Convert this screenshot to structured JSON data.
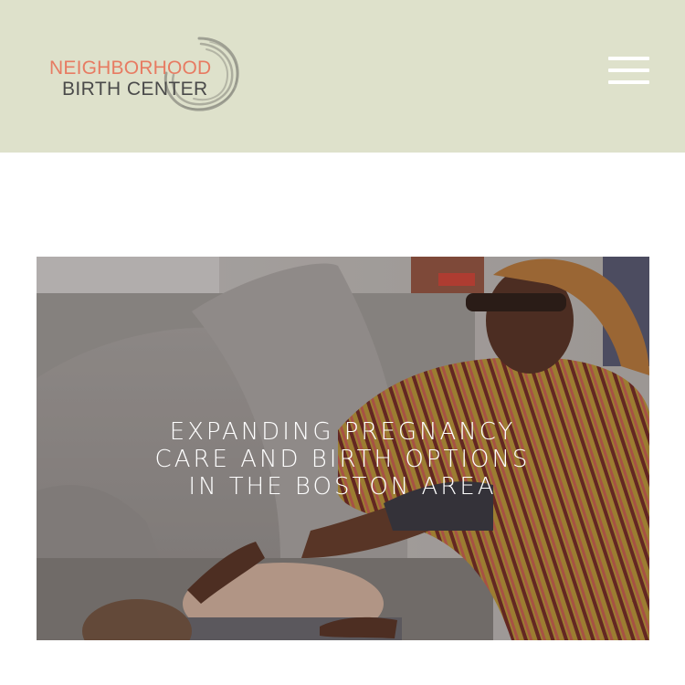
{
  "header": {
    "background_color": "#dee1cb",
    "logo": {
      "line1": "NEIGHBORHOOD",
      "line2": "BIRTH CENTER",
      "line1_color": "#e77b62",
      "line2_color": "#4a4a4a",
      "icon": "swirl-logo-icon"
    },
    "menu": {
      "icon": "hamburger-menu-icon",
      "color": "#ffffff"
    }
  },
  "hero": {
    "heading_lines": [
      "EXPANDING PREGNANCY",
      "CARE AND BIRTH OPTIONS",
      "IN THE BOSTON AREA"
    ],
    "heading_color": "#ffffff"
  }
}
